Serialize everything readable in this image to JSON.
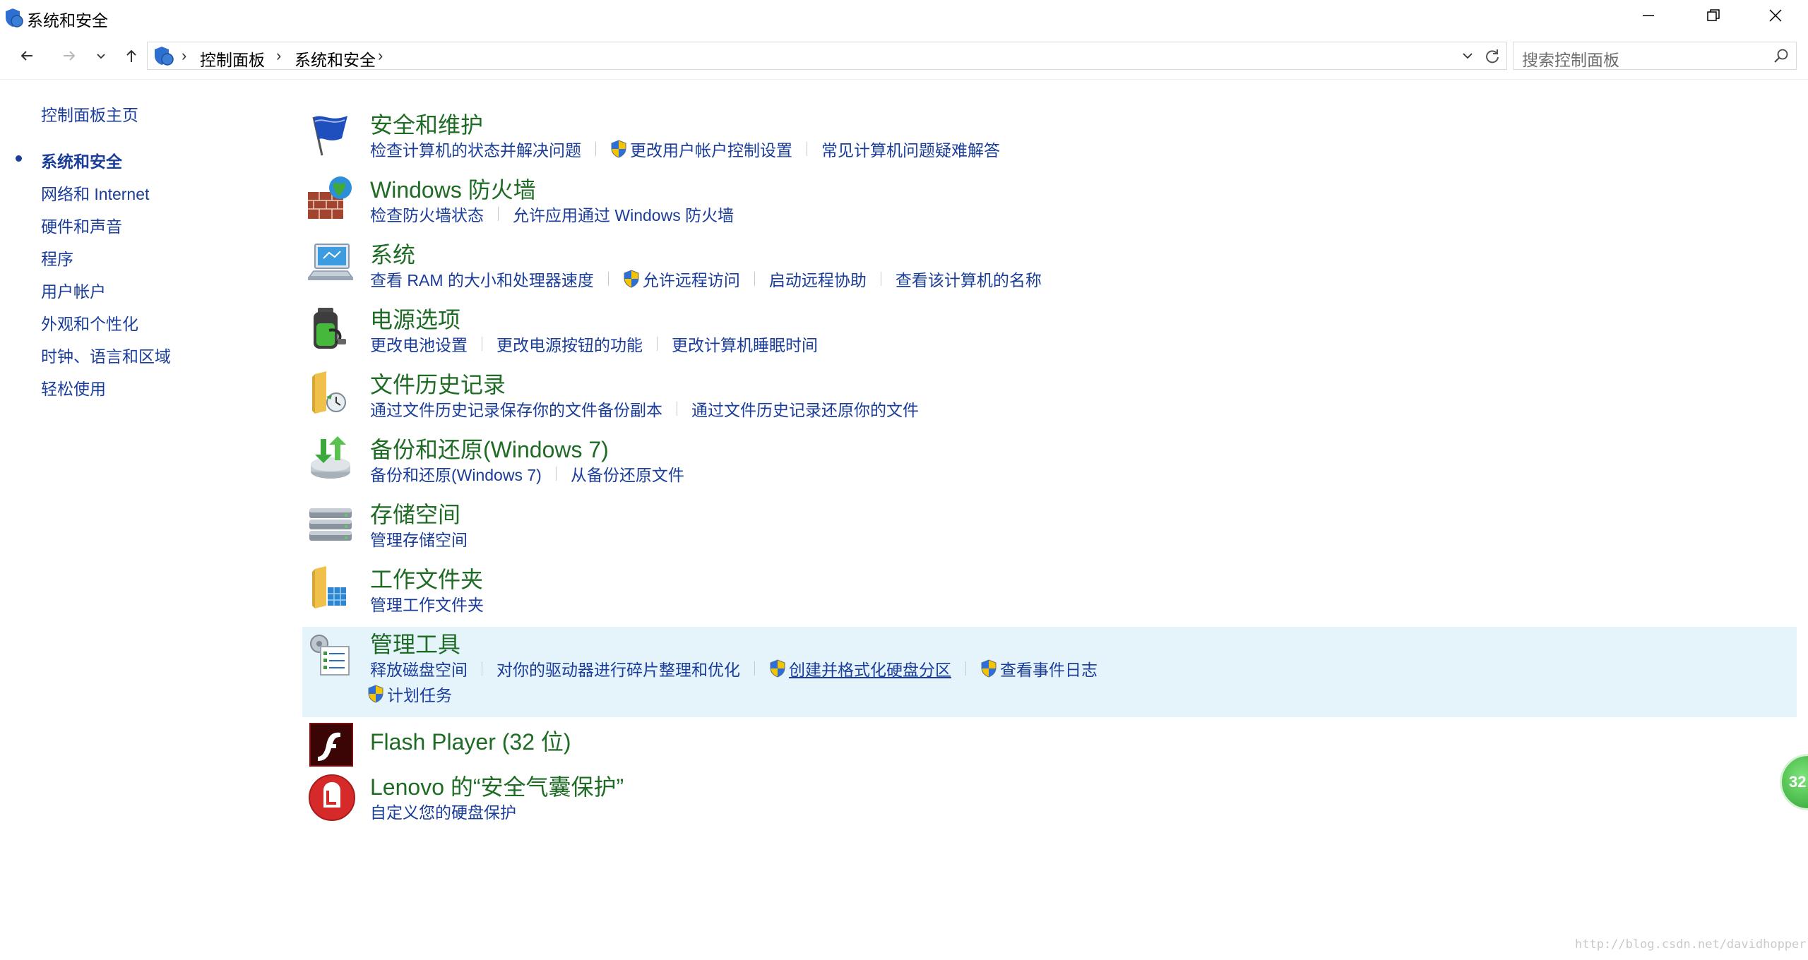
{
  "window": {
    "title": "系统和安全",
    "controls": {
      "minimize": "minimize-icon",
      "restore": "restore-icon",
      "close": "close-icon"
    }
  },
  "address": {
    "crumbs": [
      "控制面板",
      "系统和安全"
    ],
    "search_placeholder": "搜索控制面板"
  },
  "sidebar": {
    "home": "控制面板主页",
    "items": [
      {
        "label": "系统和安全",
        "current": true
      },
      {
        "label": "网络和 Internet"
      },
      {
        "label": "硬件和声音"
      },
      {
        "label": "程序"
      },
      {
        "label": "用户帐户"
      },
      {
        "label": "外观和个性化"
      },
      {
        "label": "时钟、语言和区域"
      },
      {
        "label": "轻松使用"
      }
    ]
  },
  "categories": [
    {
      "title": "安全和维护",
      "icon": "flag-icon",
      "links": [
        "检查计算机的状态并解决问题",
        "更改用户帐户控制设置",
        "常见计算机问题疑难解答"
      ]
    },
    {
      "title": "Windows 防火墙",
      "icon": "firewall-icon",
      "links": [
        "检查防火墙状态",
        "允许应用通过 Windows 防火墙"
      ]
    },
    {
      "title": "系统",
      "icon": "computer-icon",
      "links": [
        "查看 RAM 的大小和处理器速度",
        "允许远程访问",
        "启动远程协助",
        "查看该计算机的名称"
      ]
    },
    {
      "title": "电源选项",
      "icon": "battery-icon",
      "links": [
        "更改电池设置",
        "更改电源按钮的功能",
        "更改计算机睡眠时间"
      ]
    },
    {
      "title": "文件历史记录",
      "icon": "file-history-icon",
      "links": [
        "通过文件历史记录保存你的文件备份副本",
        "通过文件历史记录还原你的文件"
      ]
    },
    {
      "title": "备份和还原(Windows 7)",
      "icon": "backup-icon",
      "links": [
        "备份和还原(Windows 7)",
        "从备份还原文件"
      ]
    },
    {
      "title": "存储空间",
      "icon": "storage-icon",
      "links": [
        "管理存储空间"
      ]
    },
    {
      "title": "工作文件夹",
      "icon": "work-folders-icon",
      "links": [
        "管理工作文件夹"
      ]
    },
    {
      "title": "管理工具",
      "icon": "admin-tools-icon",
      "links": [
        "释放磁盘空间",
        "对你的驱动器进行碎片整理和优化",
        "创建并格式化硬盘分区",
        "查看事件日志",
        "计划任务"
      ]
    },
    {
      "title": "Flash Player (32 位)",
      "icon": "flash-icon",
      "links": []
    },
    {
      "title": "Lenovo 的“安全气囊保护”",
      "icon": "lenovo-airbag-icon",
      "links": [
        "自定义您的硬盘保护"
      ]
    }
  ],
  "floater_badge": "32",
  "watermark": "http://blog.csdn.net/davidhopper",
  "colors": {
    "heading": "#1e6b24",
    "link": "#1a3d9a",
    "highlight": "#e5f3fb"
  }
}
